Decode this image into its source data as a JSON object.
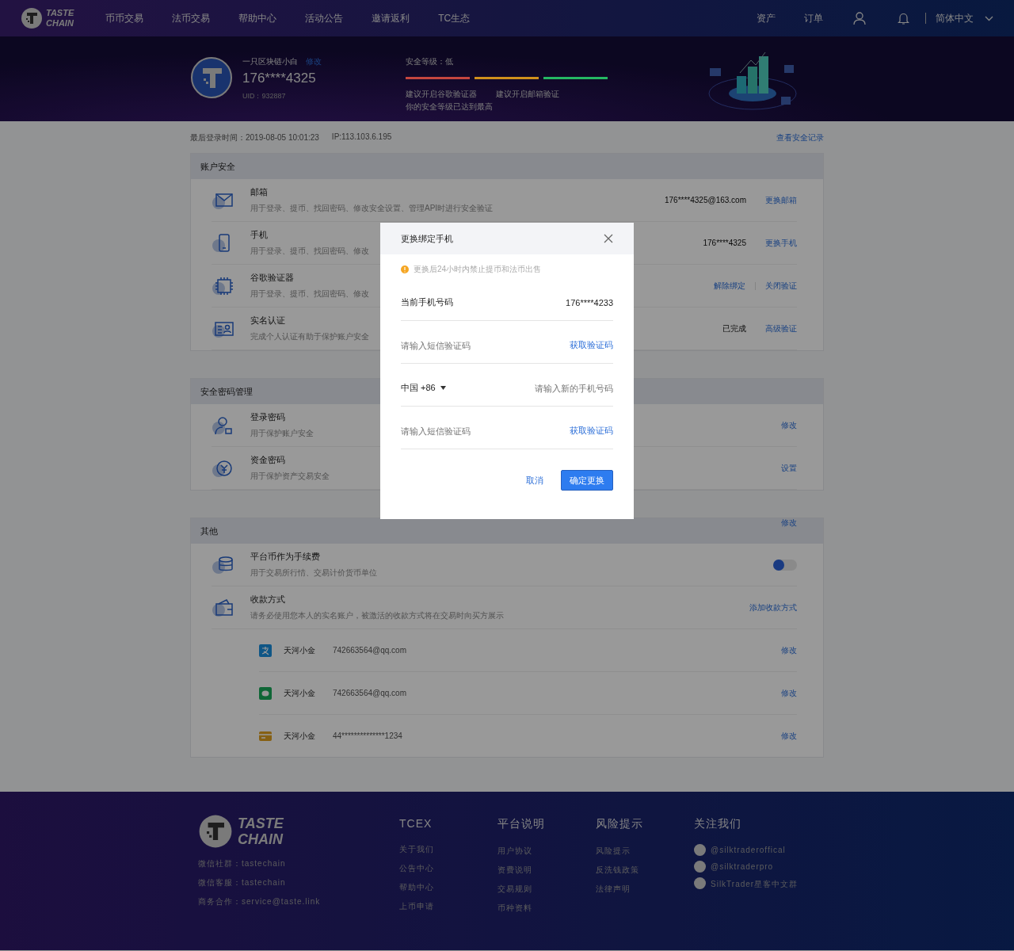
{
  "nav": {
    "logo": [
      "TASTE",
      "CHAIN"
    ],
    "items": [
      {
        "label": "币币交易"
      },
      {
        "label": "法币交易"
      },
      {
        "label": "帮助中心"
      },
      {
        "label": "活动公告"
      },
      {
        "label": "邀请返利"
      },
      {
        "label": "TC生态"
      }
    ],
    "right": [
      {
        "label": "资产"
      },
      {
        "label": "订单"
      }
    ],
    "language": "简体中文"
  },
  "profile": {
    "nickname": "一只区块链小白",
    "edit": "修改",
    "phone": "176****4325",
    "uid": "UID：932887",
    "security_label": "安全等级：低",
    "bars": [
      {
        "color": "#c4463f"
      },
      {
        "color": "#d0901c"
      },
      {
        "color": "#25b863"
      }
    ],
    "tips": [
      "建议开启谷歌验证器",
      "建议开启邮箱验证"
    ],
    "tip2": "你的安全等级已达到最高"
  },
  "login_info": {
    "time": "最后登录时间：2019-08-05 10:01:23",
    "ip": "IP:113.103.6.195",
    "link": "查看安全记录"
  },
  "sections": [
    {
      "title": "账户安全",
      "rows": [
        {
          "kind": "email",
          "title": "邮箱",
          "desc": "用于登录、提币、找回密码、修改安全设置、管理API时进行安全验证",
          "value": "176****4325@163.com",
          "actions": [
            "更换邮箱"
          ]
        },
        {
          "kind": "phone",
          "title": "手机",
          "desc": "用于登录、提币、找回密码、修改",
          "value": "176****4325",
          "actions": [
            "更换手机"
          ]
        },
        {
          "kind": "google",
          "title": "谷歌验证器",
          "desc": "用于登录、提币、找回密码、修改",
          "actions": [
            "解除绑定",
            "关闭验证"
          ]
        },
        {
          "kind": "id",
          "title": "实名认证",
          "desc": "完成个人认证有助于保护账户安全",
          "value": "已完成",
          "actions": [
            "高级验证"
          ]
        }
      ]
    },
    {
      "title": "安全密码管理",
      "rows": [
        {
          "kind": "login",
          "title": "登录密码",
          "desc": "用于保护账户安全",
          "actions": [
            "修改"
          ]
        },
        {
          "kind": "fund",
          "title": "资金密码",
          "desc": "用于保护资产交易安全",
          "actions": [
            "设置"
          ]
        }
      ]
    },
    {
      "title": "其他",
      "header_action": "修改",
      "rows": [
        {
          "kind": "coin",
          "title": "平台币作为手续费",
          "desc": "用于交易所行情、交易计价货币单位",
          "toggle": {
            "on": false
          }
        },
        {
          "kind": "wallet",
          "title": "收款方式",
          "desc": "请务必使用您本人的实名账户，被激活的收款方式将在交易时向买方展示",
          "actions": [
            "添加收款方式"
          ]
        }
      ],
      "payments": [
        {
          "kind": "alipay",
          "name": "天河小金",
          "account": "742663564@qq.com",
          "action": "修改"
        },
        {
          "kind": "wechat",
          "name": "天河小金",
          "account": "742663564@qq.com",
          "action": "修改"
        },
        {
          "kind": "bank",
          "name": "天河小金",
          "account": "44**************1234",
          "action": "修改"
        }
      ]
    }
  ],
  "dialog": {
    "title": "更换绑定手机",
    "warning": "更换后24小时内禁止提币和法币出售",
    "current_label": "当前手机号码",
    "current_value": "176****4233",
    "code_placeholder": "请输入短信验证码",
    "get_code": "获取验证码",
    "country": "中国 +86",
    "phone_placeholder": "请输入新的手机号码",
    "code2_placeholder": "请输入短信验证码",
    "get_code2": "获取验证码",
    "cancel": "取消",
    "confirm": "确定更换"
  },
  "footer": {
    "logo": [
      "TASTE",
      "CHAIN"
    ],
    "contacts": [
      "微信社群：tastechain",
      "微信客服：tastechain",
      "商务合作：service@taste.link"
    ],
    "columns": [
      {
        "title": "TCEX",
        "links": [
          "关于我们",
          "公告中心",
          "帮助中心",
          "上币申请"
        ]
      },
      {
        "title": "平台说明",
        "links": [
          "用户协议",
          "资费说明",
          "交易规则",
          "币种资料"
        ]
      },
      {
        "title": "风险提示",
        "links": [
          "风险提示",
          "反洗钱政策",
          "法律声明"
        ]
      }
    ],
    "follow": {
      "title": "关注我们",
      "links": [
        "@silktraderoffical",
        "@silktraderpro",
        "SilkTrader星客中文群"
      ]
    }
  }
}
